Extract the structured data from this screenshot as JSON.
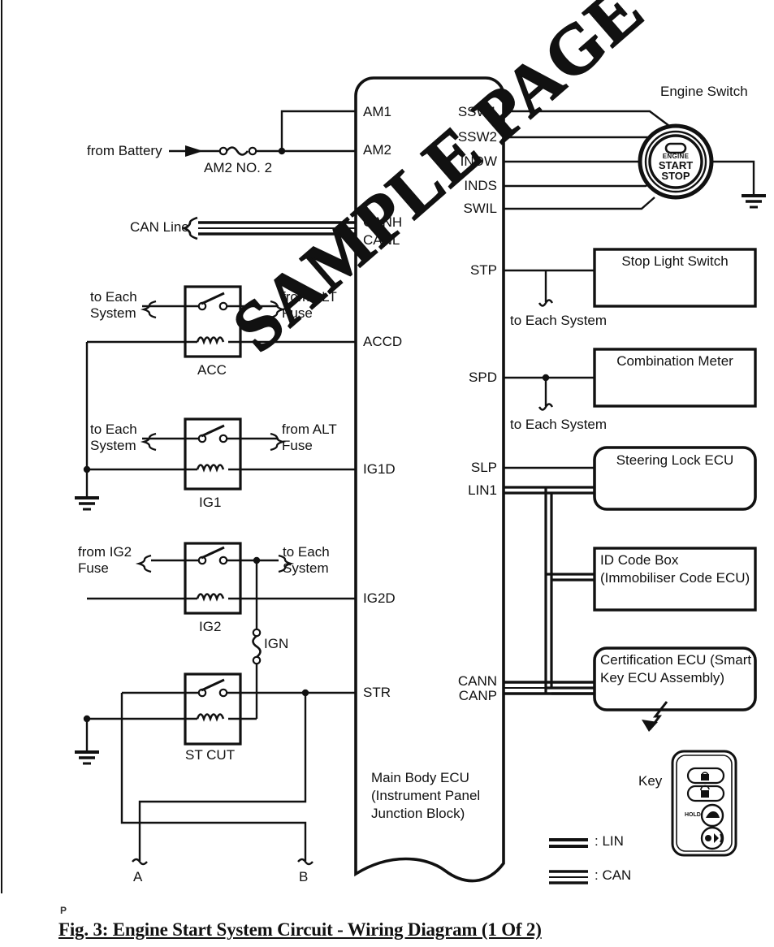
{
  "figure": {
    "page_marker": "P",
    "caption": "Fig. 3: Engine Start System Circuit - Wiring Diagram (1 Of 2)",
    "watermark": "SAMPLE PAGE"
  },
  "ecu": {
    "name_line1": "Main Body ECU",
    "name_line2": "(Instrument Panel",
    "name_line3": "Junction Block)",
    "left_pins": [
      {
        "label": "AM1"
      },
      {
        "label": "AM2"
      },
      {
        "label": "CANH"
      },
      {
        "label": "CANL"
      },
      {
        "label": "ACCD"
      },
      {
        "label": "IG1D"
      },
      {
        "label": "IG2D"
      },
      {
        "label": "STR"
      }
    ],
    "right_pins": [
      {
        "label": "SSW1"
      },
      {
        "label": "SSW2"
      },
      {
        "label": "INDW"
      },
      {
        "label": "INDS"
      },
      {
        "label": "SWIL"
      },
      {
        "label": "STP"
      },
      {
        "label": "SPD"
      },
      {
        "label": "SLP"
      },
      {
        "label": "LIN1"
      },
      {
        "label": "CANN"
      },
      {
        "label": "CANP"
      }
    ]
  },
  "left": {
    "from_battery": "from Battery",
    "fuse_am2": "AM2 NO. 2",
    "can_line": "CAN Line",
    "relays": [
      {
        "name": "ACC",
        "left_label": "to Each\nSystem",
        "right_label": "from ALT\nFuse"
      },
      {
        "name": "IG1",
        "left_label": "to Each\nSystem",
        "right_label": "from ALT\nFuse"
      },
      {
        "name": "IG2",
        "left_label": "from IG2\nFuse",
        "right_label": "to Each\nSystem"
      },
      {
        "name": "ST CUT",
        "left_label": "",
        "right_label": ""
      }
    ],
    "fuse_ign": "IGN",
    "terminal_a": "A",
    "terminal_b": "B"
  },
  "right": {
    "engine_switch_label": "Engine Switch",
    "engine_switch_button": {
      "line1": "ENGINE",
      "line2": "START",
      "line3": "STOP"
    },
    "to_each_system_stp": "to Each System",
    "to_each_system_spd": "to Each System",
    "boxes": [
      {
        "line1": "Stop Light Switch",
        "line2": ""
      },
      {
        "line1": "Combination Meter",
        "line2": ""
      },
      {
        "line1": "Steering Lock ECU",
        "line2": ""
      },
      {
        "line1": "ID Code Box",
        "line2": "(Immobiliser Code ECU)"
      },
      {
        "line1": "Certification ECU (Smart",
        "line2": "Key ECU Assembly)"
      }
    ],
    "key_label": "Key",
    "key_hold_label": "HOLD"
  },
  "legend": [
    {
      "symbol": "lin-bus",
      "text": ": LIN"
    },
    {
      "symbol": "can-bus",
      "text": ": CAN"
    }
  ],
  "colors": {
    "line": "#111111",
    "text": "#111111",
    "background": "#ffffff"
  }
}
